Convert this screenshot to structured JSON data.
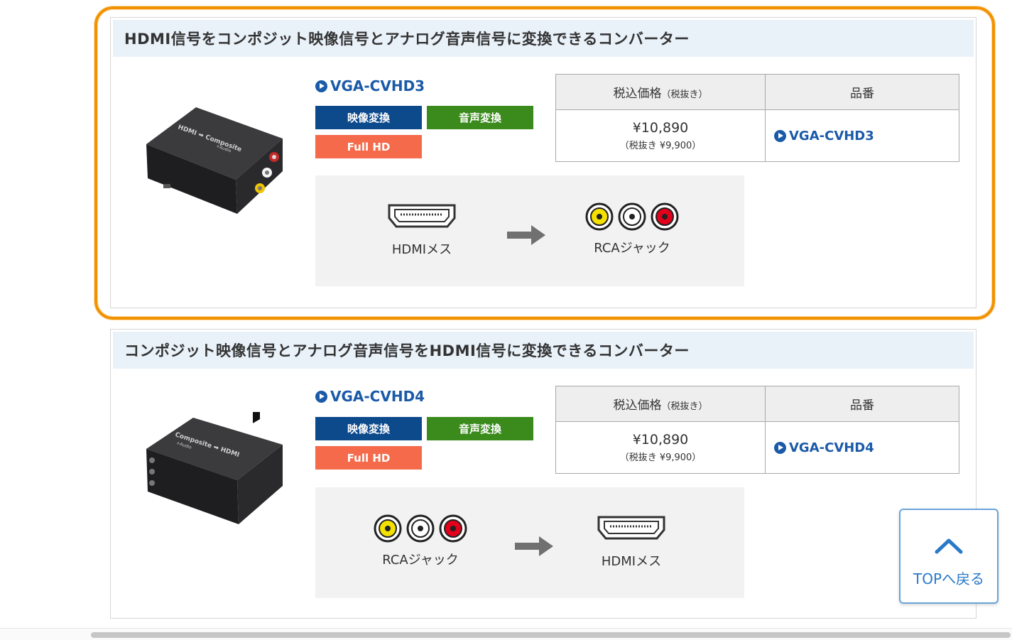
{
  "products": [
    {
      "heading": "HDMI信号をコンポジット映像信号とアナログ音声信号に変換できるコンバーター",
      "model": "VGA-CVHD3",
      "tags": [
        "映像変換",
        "音声変換",
        "Full HD"
      ],
      "table": {
        "price_header": "税込価格",
        "price_header_note": "（税抜き）",
        "code_header": "品番",
        "price": "¥10,890",
        "price_excl": "（税抜き ¥9,900）",
        "code": "VGA-CVHD3"
      },
      "device_label": "HDMI ➡ Composite",
      "device_sub": "+Audio",
      "diagram": {
        "from": "HDMIメス",
        "to": "RCAジャック"
      }
    },
    {
      "heading": "コンポジット映像信号とアナログ音声信号をHDMI信号に変換できるコンバーター",
      "model": "VGA-CVHD4",
      "tags": [
        "映像変換",
        "音声変換",
        "Full HD"
      ],
      "table": {
        "price_header": "税込価格",
        "price_header_note": "（税抜き）",
        "code_header": "品番",
        "price": "¥10,890",
        "price_excl": "（税抜き ¥9,900）",
        "code": "VGA-CVHD4"
      },
      "device_label": "Composite ➡ HDMI",
      "device_sub": "+Audio",
      "diagram": {
        "from": "RCAジャック",
        "to": "HDMIメス"
      }
    }
  ],
  "to_top": {
    "label": "TOPへ戻る",
    "icon": "chevron-up-icon"
  },
  "colors": {
    "highlight": "#f39200",
    "header_bg": "#e9f1f9",
    "link": "#1a5aa8",
    "tag_video": "#0d4a8c",
    "tag_audio": "#3a8b1c",
    "tag_hd": "#f56a4a"
  }
}
